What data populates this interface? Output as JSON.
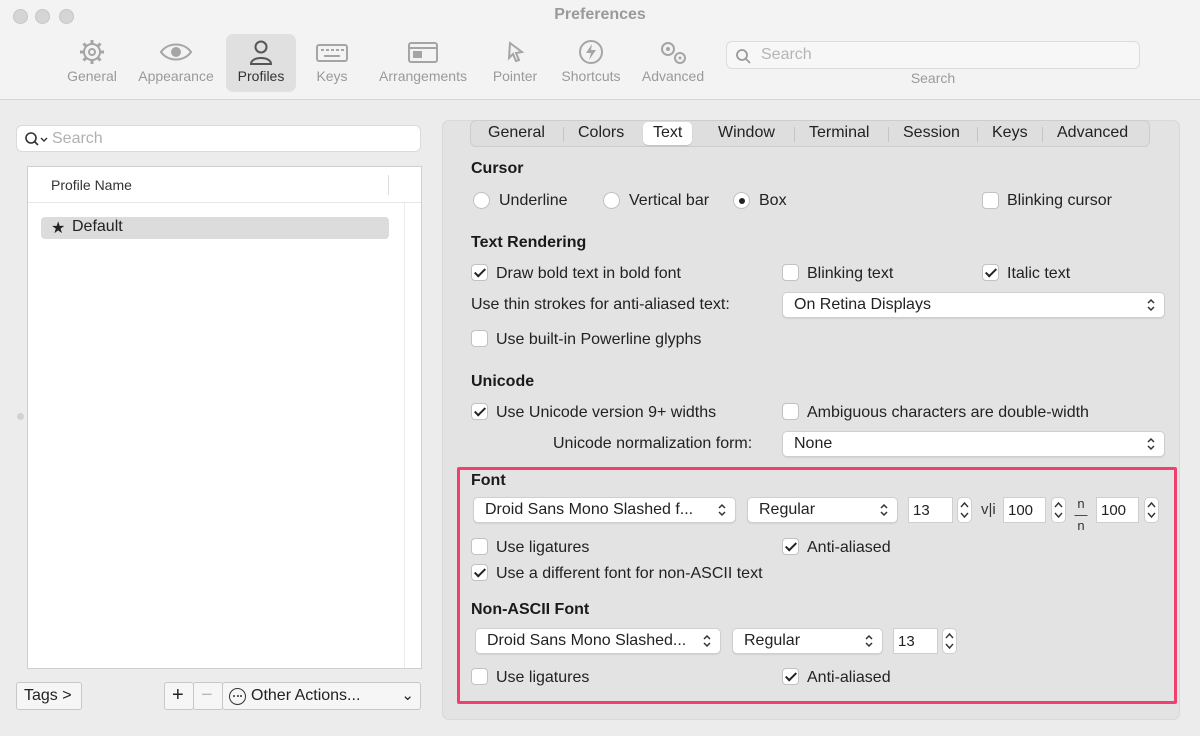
{
  "window": {
    "title": "Preferences"
  },
  "toolbar": {
    "items": [
      {
        "label": "General",
        "icon": "gear-icon"
      },
      {
        "label": "Appearance",
        "icon": "eye-icon"
      },
      {
        "label": "Profiles",
        "icon": "person-icon"
      },
      {
        "label": "Keys",
        "icon": "keyboard-icon"
      },
      {
        "label": "Arrangements",
        "icon": "windows-icon"
      },
      {
        "label": "Pointer",
        "icon": "pointer-icon"
      },
      {
        "label": "Shortcuts",
        "icon": "bolt-icon"
      },
      {
        "label": "Advanced",
        "icon": "gears-icon"
      }
    ],
    "active": "Profiles",
    "search_placeholder": "Search",
    "search_caption": "Search"
  },
  "profiles": {
    "search_placeholder": "Search",
    "column_header": "Profile Name",
    "items": [
      {
        "name": "Default",
        "default": true
      }
    ],
    "tags_button": "Tags >",
    "add_button": "+",
    "remove_button": "−",
    "other_actions": "Other Actions..."
  },
  "tabs": {
    "items": [
      "General",
      "Colors",
      "Text",
      "Window",
      "Terminal",
      "Session",
      "Keys",
      "Advanced"
    ],
    "active": "Text"
  },
  "cursor": {
    "title": "Cursor",
    "options": [
      "Underline",
      "Vertical bar",
      "Box"
    ],
    "selected": "Box",
    "blinking_label": "Blinking cursor",
    "blinking": false
  },
  "text_rendering": {
    "title": "Text Rendering",
    "bold_label": "Draw bold text in bold font",
    "bold": true,
    "blinking_text_label": "Blinking text",
    "blinking_text": false,
    "italic_label": "Italic text",
    "italic": true,
    "thin_strokes_label": "Use thin strokes for anti-aliased text:",
    "thin_strokes_value": "On Retina Displays",
    "powerline_label": "Use built-in Powerline glyphs",
    "powerline": false
  },
  "unicode": {
    "title": "Unicode",
    "v9_label": "Use Unicode version 9+ widths",
    "v9": true,
    "ambiguous_label": "Ambiguous characters are double-width",
    "ambiguous": false,
    "normalization_label": "Unicode normalization form:",
    "normalization_value": "None"
  },
  "font": {
    "title": "Font",
    "family": "Droid Sans Mono Slashed f...",
    "style": "Regular",
    "size": "13",
    "h_spacing_icon": "v|i",
    "h_spacing": "100",
    "v_spacing_icon": "n/n",
    "v_spacing": "100",
    "ligatures_label": "Use ligatures",
    "ligatures": false,
    "antialiased_label": "Anti-aliased",
    "antialiased": true,
    "non_ascii_label": "Use a different font for non-ASCII text",
    "non_ascii": true
  },
  "non_ascii_font": {
    "title": "Non-ASCII Font",
    "family": "Droid Sans Mono Slashed...",
    "style": "Regular",
    "size": "13",
    "ligatures_label": "Use ligatures",
    "ligatures": false,
    "antialiased_label": "Anti-aliased",
    "antialiased": true
  },
  "colors": {
    "highlight": "#f0406e"
  }
}
